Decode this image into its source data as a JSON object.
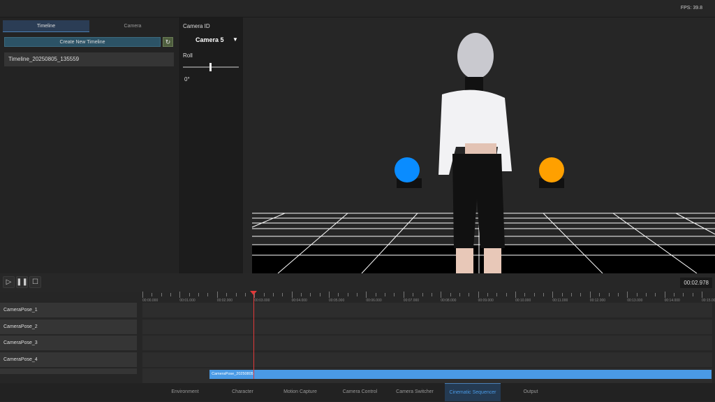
{
  "status": {
    "fps": "FPS: 39.8"
  },
  "left_panel": {
    "tabs": [
      {
        "label": "Timeline",
        "active": true
      },
      {
        "label": "Camera",
        "active": false
      }
    ],
    "create_button": "Create New Timeline",
    "refresh_icon": "refresh-icon",
    "timelines": [
      "Timeline_20250805_135559"
    ]
  },
  "camera_panel": {
    "camera_id_label": "Camera ID",
    "camera_selected": "Camera 5",
    "dropdown_arrow": "▼",
    "roll_label": "Roll",
    "roll_value": "0°",
    "roll_fraction": 0.5
  },
  "viewport": {
    "sphere_colors": [
      "#0a8cff",
      "#ffa000"
    ]
  },
  "sequencer": {
    "current_time": "00:02.978",
    "playhead_seconds": 2.978,
    "ruler_labels": [
      "00:00.000",
      "00:01.000",
      "00:02.000",
      "00:03.000",
      "00:04.000",
      "00:05.000",
      "00:06.000",
      "00:07.000",
      "00:08.000",
      "00:09.000",
      "00:10.000",
      "00:11.000",
      "00:12.000",
      "00:13.000",
      "00:14.000",
      "00:15.000"
    ],
    "tracks": [
      "CameraPose_1",
      "CameraPose_2",
      "CameraPose_3",
      "CameraPose_4"
    ],
    "clip": {
      "label": "CameraPose_20250805",
      "start_seconds": 1.8
    }
  },
  "bottom_tabs": [
    {
      "label": "Environment"
    },
    {
      "label": "Character"
    },
    {
      "label": "Motion Capture"
    },
    {
      "label": "Camera Control"
    },
    {
      "label": "Camera Switcher"
    },
    {
      "label": "Cinematic Sequencer",
      "active": true
    },
    {
      "label": "Output"
    }
  ]
}
